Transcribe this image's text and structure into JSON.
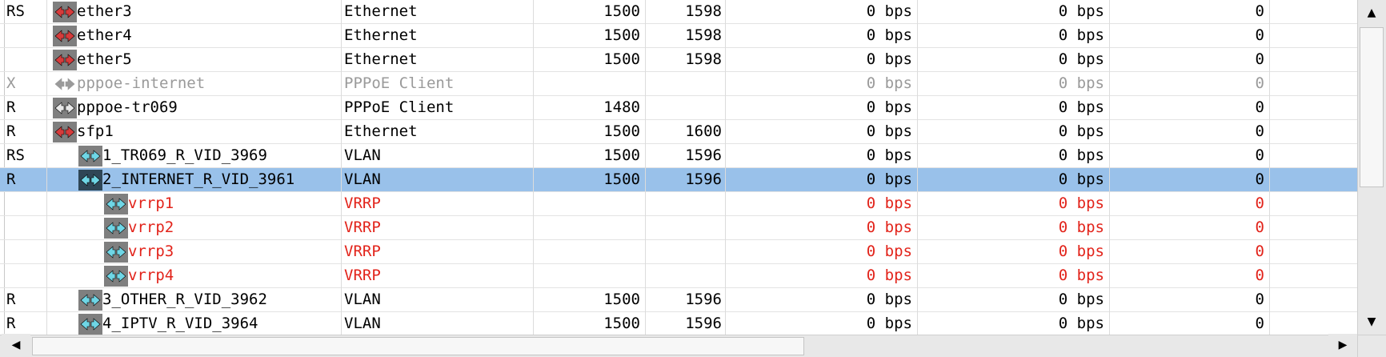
{
  "colors": {
    "selected_row_bg": "#99c1ea",
    "vrrp_text": "#e2231a",
    "disabled_text": "#9a9a9a",
    "icon_box_grey": "#7f7f7f",
    "icon_box_selected": "#2f4656",
    "icon_arrows_red": "#d63b3b",
    "icon_arrows_cyan": "#6fd6e6"
  },
  "rows": [
    {
      "flags": "RS",
      "icon": "ethernet-port-icon",
      "name": "ether3",
      "type": "Ethernet",
      "mtu": "1500",
      "l2mtu": "1598",
      "tx": "0 bps",
      "rx": "0 bps",
      "packets": "0"
    },
    {
      "flags": "",
      "icon": "ethernet-port-icon",
      "name": "ether4",
      "type": "Ethernet",
      "mtu": "1500",
      "l2mtu": "1598",
      "tx": "0 bps",
      "rx": "0 bps",
      "packets": "0"
    },
    {
      "flags": "",
      "icon": "ethernet-port-icon",
      "name": "ether5",
      "type": "Ethernet",
      "mtu": "1500",
      "l2mtu": "1598",
      "tx": "0 bps",
      "rx": "0 bps",
      "packets": "0"
    },
    {
      "flags": "X",
      "icon": "pppoe-client-icon",
      "name": "pppoe-internet",
      "type": "PPPoE Client",
      "mtu": "",
      "l2mtu": "",
      "tx": "0 bps",
      "rx": "0 bps",
      "packets": "0"
    },
    {
      "flags": "R",
      "icon": "pppoe-client-icon",
      "name": "pppoe-tr069",
      "type": "PPPoE Client",
      "mtu": "1480",
      "l2mtu": "",
      "tx": "0 bps",
      "rx": "0 bps",
      "packets": "0"
    },
    {
      "flags": "R",
      "icon": "ethernet-port-icon",
      "name": "sfp1",
      "type": "Ethernet",
      "mtu": "1500",
      "l2mtu": "1600",
      "tx": "0 bps",
      "rx": "0 bps",
      "packets": "0"
    },
    {
      "flags": "RS",
      "icon": "vlan-icon",
      "name": "1_TR069_R_VID_3969",
      "type": "VLAN",
      "mtu": "1500",
      "l2mtu": "1596",
      "tx": "0 bps",
      "rx": "0 bps",
      "packets": "0"
    },
    {
      "flags": "R",
      "icon": "vlan-icon",
      "name": "2_INTERNET_R_VID_3961",
      "type": "VLAN",
      "mtu": "1500",
      "l2mtu": "1596",
      "tx": "0 bps",
      "rx": "0 bps",
      "packets": "0"
    },
    {
      "flags": "",
      "icon": "vrrp-icon",
      "name": "vrrp1",
      "type": "VRRP",
      "mtu": "",
      "l2mtu": "",
      "tx": "0 bps",
      "rx": "0 bps",
      "packets": "0"
    },
    {
      "flags": "",
      "icon": "vrrp-icon",
      "name": "vrrp2",
      "type": "VRRP",
      "mtu": "",
      "l2mtu": "",
      "tx": "0 bps",
      "rx": "0 bps",
      "packets": "0"
    },
    {
      "flags": "",
      "icon": "vrrp-icon",
      "name": "vrrp3",
      "type": "VRRP",
      "mtu": "",
      "l2mtu": "",
      "tx": "0 bps",
      "rx": "0 bps",
      "packets": "0"
    },
    {
      "flags": "",
      "icon": "vrrp-icon",
      "name": "vrrp4",
      "type": "VRRP",
      "mtu": "",
      "l2mtu": "",
      "tx": "0 bps",
      "rx": "0 bps",
      "packets": "0"
    },
    {
      "flags": "R",
      "icon": "vlan-icon",
      "name": "3_OTHER_R_VID_3962",
      "type": "VLAN",
      "mtu": "1500",
      "l2mtu": "1596",
      "tx": "0 bps",
      "rx": "0 bps",
      "packets": "0"
    },
    {
      "flags": "R",
      "icon": "vlan-icon",
      "name": "4_IPTV_R_VID_3964",
      "type": "VLAN",
      "mtu": "1500",
      "l2mtu": "1596",
      "tx": "0 bps",
      "rx": "0 bps",
      "packets": "0"
    }
  ],
  "selected_row": 7,
  "disabled_rows": [
    3
  ],
  "scrollbars": {
    "up_icon": "arrow-up-icon",
    "down_icon": "arrow-down-icon",
    "left_icon": "arrow-left-icon",
    "right_icon": "arrow-right-icon",
    "up_glyph": "▲",
    "down_glyph": "▼",
    "left_glyph": "◀",
    "right_glyph": "▶"
  }
}
